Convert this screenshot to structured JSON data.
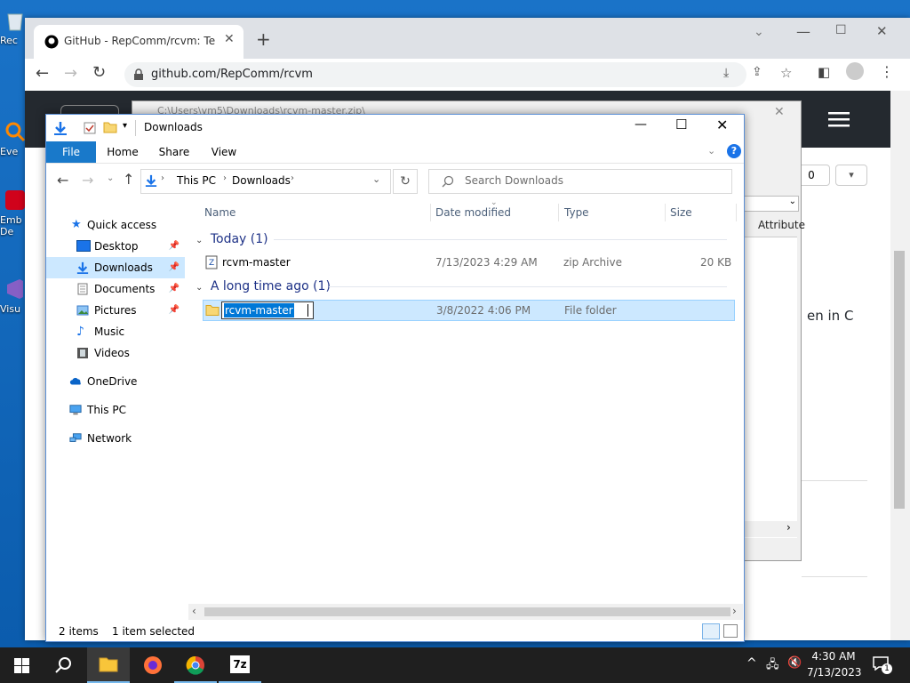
{
  "desktop": {
    "icons": [
      {
        "label": "Rec",
        "name": "recycle-bin"
      },
      {
        "label": "Eve",
        "name": "everything"
      },
      {
        "label": "Emb De",
        "name": "embarcadero"
      },
      {
        "label": "Visu",
        "name": "visual-studio"
      }
    ]
  },
  "chrome": {
    "tab_title": "GitHub - RepComm/rcvm: Test v",
    "url": "github.com/RepComm/rcvm",
    "behind_text_attribute": "Attribute",
    "behind_text_count": "0",
    "behind_text_snippet": "en in C"
  },
  "sevenz": {
    "title": "C:\\Users\\vm5\\Downloads\\rcvm-master.zip\\"
  },
  "explorer": {
    "title": "Downloads",
    "ribbon_tabs": {
      "file": "File",
      "home": "Home",
      "share": "Share",
      "view": "View"
    },
    "breadcrumb": {
      "this_pc": "This PC",
      "downloads": "Downloads"
    },
    "search_placeholder": "Search Downloads",
    "columns": {
      "name": "Name",
      "date": "Date modified",
      "type": "Type",
      "size": "Size"
    },
    "nav": {
      "quick_access": "Quick access",
      "desktop": "Desktop",
      "downloads": "Downloads",
      "documents": "Documents",
      "pictures": "Pictures",
      "music": "Music",
      "videos": "Videos",
      "onedrive": "OneDrive",
      "this_pc": "This PC",
      "network": "Network"
    },
    "groups": {
      "today": "Today (1)",
      "long_ago": "A long time ago (1)"
    },
    "files": [
      {
        "name": "rcvm-master",
        "date": "7/13/2023 4:29 AM",
        "type": "zip Archive",
        "size": "20 KB"
      },
      {
        "name": "rcvm-master",
        "date": "3/8/2022 4:06 PM",
        "type": "File folder",
        "size": ""
      }
    ],
    "status": {
      "items": "2 items",
      "selected": "1 item selected"
    }
  },
  "taskbar": {
    "time": "4:30 AM",
    "date": "7/13/2023",
    "notification_count": "1"
  },
  "colors": {
    "accent": "#0078d7",
    "selection": "#cce8ff",
    "github_header": "#24292f"
  }
}
